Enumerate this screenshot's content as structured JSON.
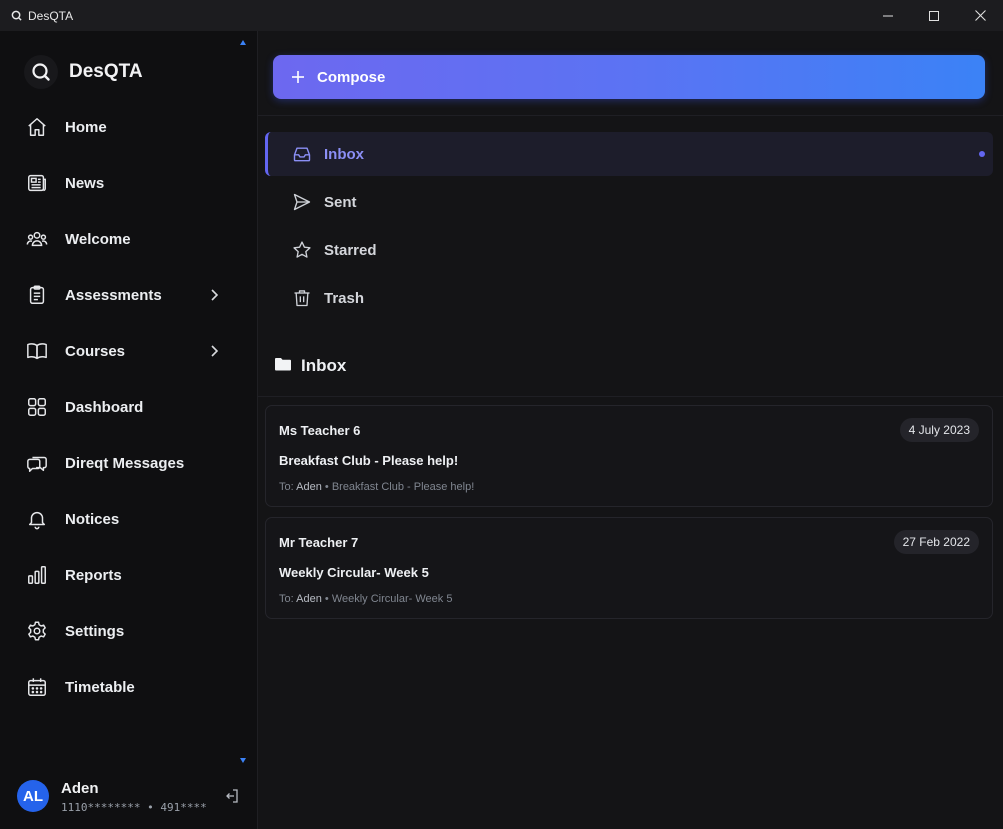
{
  "window": {
    "title": "DesQTA"
  },
  "sidebar": {
    "brand": "DesQTA",
    "items": [
      {
        "label": "Home",
        "icon": "home-icon",
        "has_submenu": false
      },
      {
        "label": "News",
        "icon": "newspaper-icon",
        "has_submenu": false
      },
      {
        "label": "Welcome",
        "icon": "users-icon",
        "has_submenu": false
      },
      {
        "label": "Assessments",
        "icon": "clipboard-icon",
        "has_submenu": true
      },
      {
        "label": "Courses",
        "icon": "book-icon",
        "has_submenu": true
      },
      {
        "label": "Dashboard",
        "icon": "grid-icon",
        "has_submenu": false
      },
      {
        "label": "Direqt Messages",
        "icon": "chat-icon",
        "has_submenu": false
      },
      {
        "label": "Notices",
        "icon": "bell-icon",
        "has_submenu": false
      },
      {
        "label": "Reports",
        "icon": "bar-chart-icon",
        "has_submenu": false
      },
      {
        "label": "Settings",
        "icon": "gear-icon",
        "has_submenu": false
      },
      {
        "label": "Timetable",
        "icon": "calendar-icon",
        "has_submenu": false
      }
    ],
    "user": {
      "initials": "AL",
      "name": "Aden",
      "meta": "1110******** • 491****"
    }
  },
  "main": {
    "compose_label": "Compose",
    "folders": [
      {
        "label": "Inbox",
        "icon": "inbox-icon",
        "active": true
      },
      {
        "label": "Sent",
        "icon": "send-icon",
        "active": false
      },
      {
        "label": "Starred",
        "icon": "star-icon",
        "active": false
      },
      {
        "label": "Trash",
        "icon": "trash-icon",
        "active": false
      }
    ],
    "section_title": "Inbox",
    "messages": [
      {
        "from": "Ms Teacher 6",
        "date": "4 July 2023",
        "subject": "Breakfast Club - Please help!",
        "to_prefix": "To:",
        "to_name": "Aden",
        "preview": "• Breakfast Club - Please help!"
      },
      {
        "from": "Mr Teacher 7",
        "date": "27 Feb 2022",
        "subject": "Weekly Circular- Week 5",
        "to_prefix": "To:",
        "to_name": "Aden",
        "preview": "• Weekly Circular- Week 5"
      }
    ]
  },
  "colors": {
    "accent": "#6366f1",
    "accent_blue": "#3b82f6",
    "avatar": "#2563eb"
  }
}
